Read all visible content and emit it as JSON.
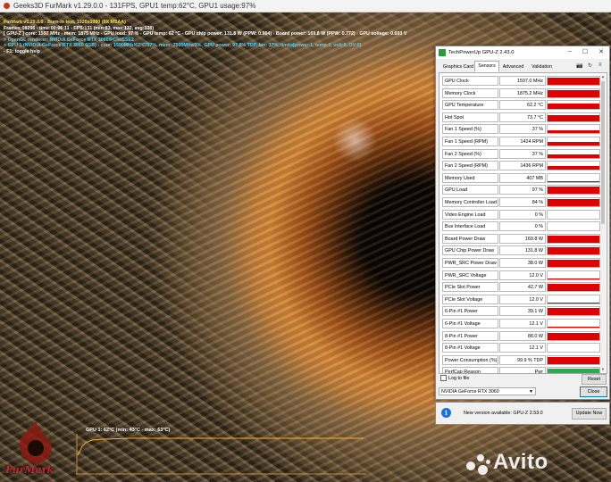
{
  "furmark": {
    "window_title": "Geeks3D FurMark v1.29.0.0 - 131FPS, GPU1 temp:62°C, GPU1 usage:97%",
    "overlay_lines": [
      {
        "text": "FurMark v1.29.0.0 - Burn-in test, 1920x1080 (8X MSAA)",
        "color": "y"
      },
      {
        "text": "Frames:08296 - time:00:06:11 - FPS:131 (min:83, max:132, avg:138)",
        "color": "w"
      },
      {
        "text": "[ GPU-Z ] core: 1597 MHz - mem: 1875 MHz - GPU load: 97 % - GPU temp: 62 °C - GPU chip power: 131.8 W (PPW: 0.994) - Board power: 169.8 W (PPW: 0.772) - GPU voltage: 0.693 V",
        "color": "w"
      },
      {
        "text": "> OpenGL renderer: NVIDIA GeForce RTX 3060/PCIe/SSE2",
        "color": "c"
      },
      {
        "text": "> GPU 1 (NVIDIA GeForce RTX 3060 6GB) - core: 1590MHz/62°C/97%, mem: 7500MHz/3%, GPU power: 97.8% TDP, fan: 37%, limits[power:1, temp:0, volt:0, OV:0]",
        "color": "c"
      },
      {
        "text": "- F1: toggle help",
        "color": "w"
      }
    ],
    "temp_chart_label": "GPU 1: 62°C (min: 43°C - max: 63°C)",
    "logo_text": "FurMark"
  },
  "gpuz": {
    "title": "TechPowerUp GPU-Z 2.43.0",
    "tabs": [
      {
        "label": "Graphics Card",
        "active": false
      },
      {
        "label": "Sensors",
        "active": true
      },
      {
        "label": "Advanced",
        "active": false
      },
      {
        "label": "Validation",
        "active": false
      }
    ],
    "sensors": [
      {
        "label": "GPU Clock",
        "value": "1597.0 MHz",
        "level": 0.85,
        "color": "#e00000"
      },
      {
        "label": "Memory Clock",
        "value": "1875.2 MHz",
        "level": 0.85,
        "color": "#e00000"
      },
      {
        "label": "GPU Temperature",
        "value": "62.2 °C",
        "level": 0.7,
        "color": "#e00000"
      },
      {
        "label": "Hot Spot",
        "value": "73.7 °C",
        "level": 0.75,
        "color": "#e00000"
      },
      {
        "label": "Fan 1 Speed (%)",
        "value": "37 %",
        "level": 0.37,
        "color": "#e00000"
      },
      {
        "label": "Fan 1 Speed (RPM)",
        "value": "1424 RPM",
        "level": 0.45,
        "color": "#e00000"
      },
      {
        "label": "Fan 2 Speed (%)",
        "value": "37 %",
        "level": 0.37,
        "color": "#e00000"
      },
      {
        "label": "Fan 2 Speed (RPM)",
        "value": "1436 RPM",
        "level": 0.45,
        "color": "#e00000"
      },
      {
        "label": "Memory Used",
        "value": "407 MB",
        "level": 0.06,
        "color": "#e00000"
      },
      {
        "label": "GPU Load",
        "value": "97 %",
        "level": 0.97,
        "color": "#e00000"
      },
      {
        "label": "Memory Controller Load",
        "value": "84 %",
        "level": 0.84,
        "color": "#e00000"
      },
      {
        "label": "Video Engine Load",
        "value": "0 %",
        "level": 0,
        "color": "#e00000"
      },
      {
        "label": "Bus Interface Load",
        "value": "0 %",
        "level": 0,
        "color": "#e00000"
      },
      {
        "label": "Board Power Draw",
        "value": "169.8 W",
        "level": 0.9,
        "color": "#e00000"
      },
      {
        "label": "GPU Chip Power Draw",
        "value": "131.8 W",
        "level": 0.9,
        "color": "#e00000"
      },
      {
        "label": "PWR_SRC Power Draw",
        "value": "38.0 W",
        "level": 0.9,
        "color": "#e00000"
      },
      {
        "label": "PWR_SRC Voltage",
        "value": "12.0 V",
        "level": 0.06,
        "color": "#e00000"
      },
      {
        "label": "PCIe Slot Power",
        "value": "42.7 W",
        "level": 0.9,
        "color": "#e00000"
      },
      {
        "label": "PCIe Slot Voltage",
        "value": "12.0 V",
        "level": 0.06,
        "color": "#e00000"
      },
      {
        "label": "6-Pin #1 Power",
        "value": "39.1 W",
        "level": 0.9,
        "color": "#e00000"
      },
      {
        "label": "6-Pin #1 Voltage",
        "value": "12.1 V",
        "level": 0.06,
        "color": "#e00000"
      },
      {
        "label": "8-Pin #1 Power",
        "value": "88.0 W",
        "level": 0.9,
        "color": "#e00000"
      },
      {
        "label": "8-Pin #1 Voltage",
        "value": "12.1 V",
        "level": 0.06,
        "color": "#e00000"
      },
      {
        "label": "Power Consumption (%)",
        "value": "99.9 % TDP",
        "level": 0.9,
        "color": "#e00000"
      },
      {
        "label": "PerfCap Reason",
        "value": "Pwr",
        "level": 0.9,
        "color": "#22b24c"
      }
    ],
    "log_to_file_label": "Log to file",
    "reset_label": "Reset",
    "gpu_select_value": "NVIDIA GeForce RTX 3060",
    "close_label": "Close"
  },
  "notification": {
    "message": "New version available: GPU-Z 2.53.0",
    "button_label": "Update Now"
  },
  "watermark": "Avito"
}
